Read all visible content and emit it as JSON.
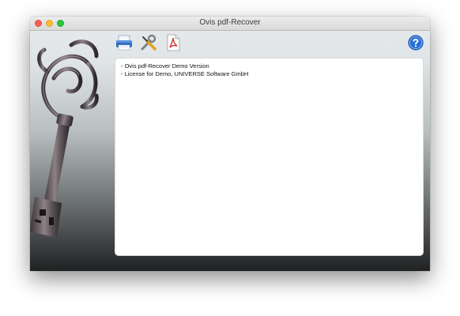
{
  "window": {
    "title": "Ovis pdf-Recover"
  },
  "toolbar": {
    "buttons": [
      {
        "icon": "printer-icon"
      },
      {
        "icon": "tools-icon"
      },
      {
        "icon": "pdf-icon"
      }
    ],
    "help_icon": "help-icon"
  },
  "log": {
    "lines": [
      "- Ovis pdf-Recover Demo Version",
      "- License for Demo, UNIVERSE Software GmbH"
    ]
  },
  "colors": {
    "close": "#fc5f57",
    "minimize": "#fdbc2e",
    "maximize": "#28c840",
    "help_blue": "#2a6fd6"
  }
}
